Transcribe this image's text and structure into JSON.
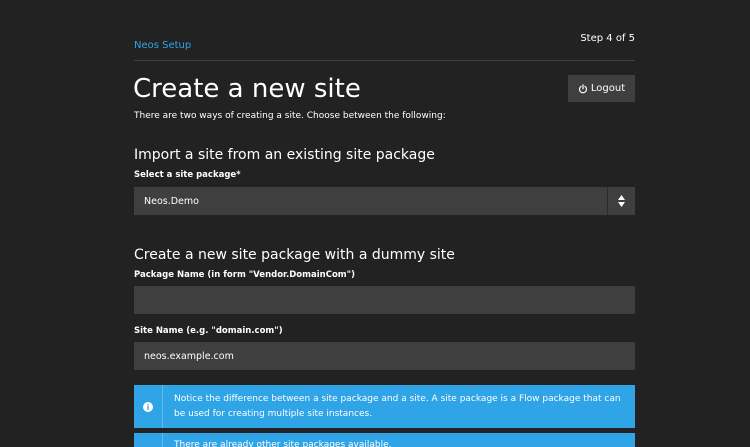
{
  "header": {
    "brand": "Neos Setup",
    "step": "Step 4 of 5"
  },
  "page": {
    "title": "Create a new site",
    "logout_label": "Logout",
    "intro": "There are two ways of creating a site. Choose between the following:"
  },
  "import_section": {
    "heading": "Import a site from an existing site package",
    "select_label": "Select a site package*",
    "selected_package": "Neos.Demo"
  },
  "new_package_section": {
    "heading": "Create a new site package with a dummy site",
    "package_name_label": "Package Name (in form \"Vendor.DomainCom\")",
    "package_name_value": "",
    "site_name_label": "Site Name (e.g. \"domain.com\")",
    "site_name_value": "neos.example.com"
  },
  "notices": [
    {
      "icon": "info-icon",
      "text": "Notice the difference between a site package and a site. A site package is a Flow package that can be used for creating multiple site instances."
    },
    {
      "icon": "info-icon",
      "text": "There are already other site packages available."
    }
  ],
  "colors": {
    "background": "#222222",
    "field": "#3f3f3f",
    "accent": "#2fa4e7"
  }
}
